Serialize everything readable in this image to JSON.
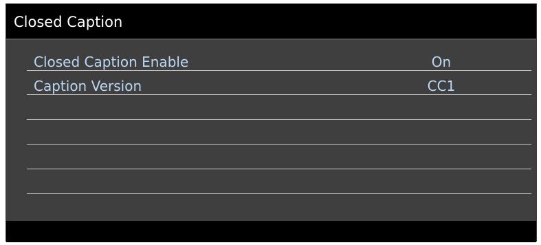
{
  "window": {
    "title": "Closed Caption"
  },
  "menu": {
    "items": [
      {
        "label": "Closed Caption Enable",
        "value": "On"
      },
      {
        "label": "Caption Version",
        "value": "CC1"
      }
    ]
  },
  "colors": {
    "title_bar_bg": "#000000",
    "panel_bg": "#3f3f3f",
    "item_text": "#bcd8f4",
    "divider": "#c8c8c8"
  }
}
